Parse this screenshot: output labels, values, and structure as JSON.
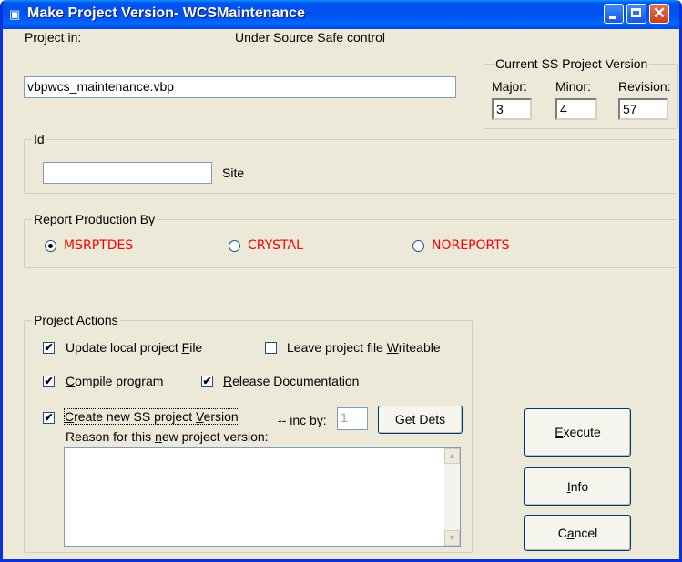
{
  "window": {
    "title": "Make Project Version- WCSMaintenance"
  },
  "project": {
    "label": "Project in:",
    "status": "Under Source Safe control",
    "file": "vbpwcs_maintenance.vbp"
  },
  "version": {
    "group_label": "Current SS Project Version",
    "major_label": "Major:",
    "minor_label": "Minor:",
    "revision_label": "Revision:",
    "major": "3",
    "minor": "4",
    "revision": "57"
  },
  "id_group": {
    "label": "Id",
    "value": "",
    "site_label": "Site"
  },
  "report": {
    "label": "Report Production By",
    "options": [
      "MSRPTDES",
      "CRYSTAL",
      "NOREPORTS"
    ],
    "selected": "MSRPTDES"
  },
  "actions": {
    "label": "Project Actions",
    "update_local": {
      "pre": "Update local project ",
      "key": "F",
      "post": "ile",
      "checked": true
    },
    "leave_writeable": {
      "pre": "Leave project file ",
      "key": "W",
      "post": "riteable",
      "checked": false
    },
    "compile": {
      "pre": "",
      "key": "C",
      "post": "ompile program",
      "checked": true
    },
    "release_docs": {
      "pre": "",
      "key": "R",
      "post": "elease Documentation",
      "checked": true
    },
    "create_version": {
      "pre": "",
      "key": "C",
      "post": "reate new SS project ",
      "key2": "V",
      "post2": "ersion",
      "checked": true
    },
    "inc_label": "-- inc by:",
    "inc_value": "1",
    "get_dets": "Get Dets",
    "reason": {
      "pre": "Reason for this ",
      "key": "n",
      "post": "ew project version:",
      "value": ""
    }
  },
  "buttons": {
    "execute": {
      "key": "E",
      "post": "xecute"
    },
    "info": {
      "key": "I",
      "post": "nfo"
    },
    "cancel": {
      "pre": "C",
      "key": "a",
      "post": "ncel"
    }
  }
}
